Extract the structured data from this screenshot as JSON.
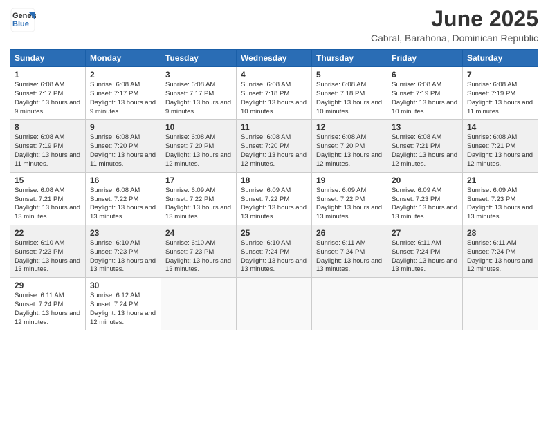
{
  "header": {
    "logo_general": "General",
    "logo_blue": "Blue",
    "title": "June 2025",
    "subtitle": "Cabral, Barahona, Dominican Republic"
  },
  "weekdays": [
    "Sunday",
    "Monday",
    "Tuesday",
    "Wednesday",
    "Thursday",
    "Friday",
    "Saturday"
  ],
  "weeks": [
    [
      {
        "day": "1",
        "sunrise": "6:08 AM",
        "sunset": "7:17 PM",
        "daylight": "13 hours and 9 minutes."
      },
      {
        "day": "2",
        "sunrise": "6:08 AM",
        "sunset": "7:17 PM",
        "daylight": "13 hours and 9 minutes."
      },
      {
        "day": "3",
        "sunrise": "6:08 AM",
        "sunset": "7:17 PM",
        "daylight": "13 hours and 9 minutes."
      },
      {
        "day": "4",
        "sunrise": "6:08 AM",
        "sunset": "7:18 PM",
        "daylight": "13 hours and 10 minutes."
      },
      {
        "day": "5",
        "sunrise": "6:08 AM",
        "sunset": "7:18 PM",
        "daylight": "13 hours and 10 minutes."
      },
      {
        "day": "6",
        "sunrise": "6:08 AM",
        "sunset": "7:19 PM",
        "daylight": "13 hours and 10 minutes."
      },
      {
        "day": "7",
        "sunrise": "6:08 AM",
        "sunset": "7:19 PM",
        "daylight": "13 hours and 11 minutes."
      }
    ],
    [
      {
        "day": "8",
        "sunrise": "6:08 AM",
        "sunset": "7:19 PM",
        "daylight": "13 hours and 11 minutes."
      },
      {
        "day": "9",
        "sunrise": "6:08 AM",
        "sunset": "7:20 PM",
        "daylight": "13 hours and 11 minutes."
      },
      {
        "day": "10",
        "sunrise": "6:08 AM",
        "sunset": "7:20 PM",
        "daylight": "13 hours and 12 minutes."
      },
      {
        "day": "11",
        "sunrise": "6:08 AM",
        "sunset": "7:20 PM",
        "daylight": "13 hours and 12 minutes."
      },
      {
        "day": "12",
        "sunrise": "6:08 AM",
        "sunset": "7:20 PM",
        "daylight": "13 hours and 12 minutes."
      },
      {
        "day": "13",
        "sunrise": "6:08 AM",
        "sunset": "7:21 PM",
        "daylight": "13 hours and 12 minutes."
      },
      {
        "day": "14",
        "sunrise": "6:08 AM",
        "sunset": "7:21 PM",
        "daylight": "13 hours and 12 minutes."
      }
    ],
    [
      {
        "day": "15",
        "sunrise": "6:08 AM",
        "sunset": "7:21 PM",
        "daylight": "13 hours and 13 minutes."
      },
      {
        "day": "16",
        "sunrise": "6:08 AM",
        "sunset": "7:22 PM",
        "daylight": "13 hours and 13 minutes."
      },
      {
        "day": "17",
        "sunrise": "6:09 AM",
        "sunset": "7:22 PM",
        "daylight": "13 hours and 13 minutes."
      },
      {
        "day": "18",
        "sunrise": "6:09 AM",
        "sunset": "7:22 PM",
        "daylight": "13 hours and 13 minutes."
      },
      {
        "day": "19",
        "sunrise": "6:09 AM",
        "sunset": "7:22 PM",
        "daylight": "13 hours and 13 minutes."
      },
      {
        "day": "20",
        "sunrise": "6:09 AM",
        "sunset": "7:23 PM",
        "daylight": "13 hours and 13 minutes."
      },
      {
        "day": "21",
        "sunrise": "6:09 AM",
        "sunset": "7:23 PM",
        "daylight": "13 hours and 13 minutes."
      }
    ],
    [
      {
        "day": "22",
        "sunrise": "6:10 AM",
        "sunset": "7:23 PM",
        "daylight": "13 hours and 13 minutes."
      },
      {
        "day": "23",
        "sunrise": "6:10 AM",
        "sunset": "7:23 PM",
        "daylight": "13 hours and 13 minutes."
      },
      {
        "day": "24",
        "sunrise": "6:10 AM",
        "sunset": "7:23 PM",
        "daylight": "13 hours and 13 minutes."
      },
      {
        "day": "25",
        "sunrise": "6:10 AM",
        "sunset": "7:24 PM",
        "daylight": "13 hours and 13 minutes."
      },
      {
        "day": "26",
        "sunrise": "6:11 AM",
        "sunset": "7:24 PM",
        "daylight": "13 hours and 13 minutes."
      },
      {
        "day": "27",
        "sunrise": "6:11 AM",
        "sunset": "7:24 PM",
        "daylight": "13 hours and 13 minutes."
      },
      {
        "day": "28",
        "sunrise": "6:11 AM",
        "sunset": "7:24 PM",
        "daylight": "13 hours and 12 minutes."
      }
    ],
    [
      {
        "day": "29",
        "sunrise": "6:11 AM",
        "sunset": "7:24 PM",
        "daylight": "13 hours and 12 minutes."
      },
      {
        "day": "30",
        "sunrise": "6:12 AM",
        "sunset": "7:24 PM",
        "daylight": "13 hours and 12 minutes."
      },
      null,
      null,
      null,
      null,
      null
    ]
  ],
  "labels": {
    "sunrise_prefix": "Sunrise: ",
    "sunset_prefix": "Sunset: ",
    "daylight_prefix": "Daylight: "
  }
}
